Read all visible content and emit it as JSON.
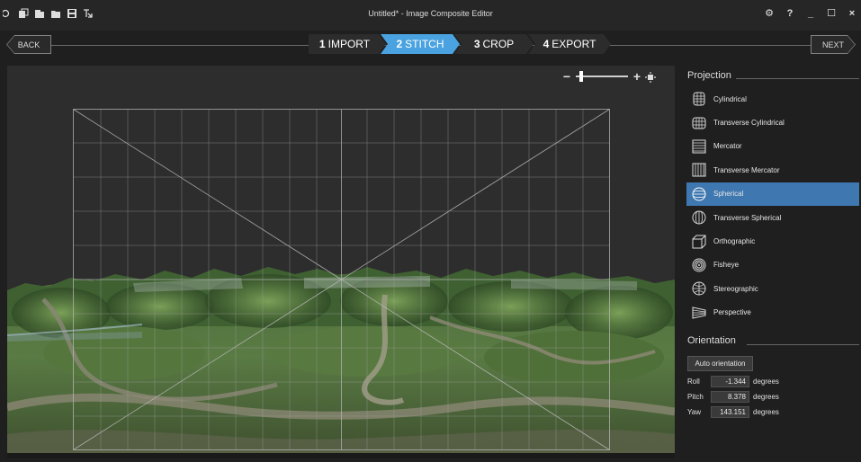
{
  "window": {
    "title": "Untitled* - Image Composite Editor",
    "controls": [
      "⚙",
      "?",
      "_",
      "☐",
      "×"
    ]
  },
  "toolbar_icons": [
    "new-project-icon",
    "new-panorama-icon",
    "open-icon",
    "save-icon",
    "export-icon"
  ],
  "nav": {
    "back_label": "BACK",
    "next_label": "NEXT",
    "steps": [
      {
        "num": "1",
        "label": "IMPORT",
        "active": false
      },
      {
        "num": "2",
        "label": "STITCH",
        "active": true
      },
      {
        "num": "3",
        "label": "CROP",
        "active": false
      },
      {
        "num": "4",
        "label": "EXPORT",
        "active": false
      }
    ]
  },
  "zoom": {
    "minus": "−",
    "plus": "+",
    "level": 0.07
  },
  "projection": {
    "heading": "Projection",
    "items": [
      {
        "label": "Cylindrical",
        "icon": "cylindrical-icon",
        "selected": false
      },
      {
        "label": "Transverse Cylindrical",
        "icon": "transverse-cylindrical-icon",
        "selected": false
      },
      {
        "label": "Mercator",
        "icon": "mercator-icon",
        "selected": false
      },
      {
        "label": "Transverse Mercator",
        "icon": "transverse-mercator-icon",
        "selected": false
      },
      {
        "label": "Spherical",
        "icon": "spherical-icon",
        "selected": true
      },
      {
        "label": "Transverse Spherical",
        "icon": "transverse-spherical-icon",
        "selected": false
      },
      {
        "label": "Orthographic",
        "icon": "orthographic-icon",
        "selected": false
      },
      {
        "label": "Fisheye",
        "icon": "fisheye-icon",
        "selected": false
      },
      {
        "label": "Stereographic",
        "icon": "stereographic-icon",
        "selected": false
      },
      {
        "label": "Perspective",
        "icon": "perspective-icon",
        "selected": false
      }
    ]
  },
  "orientation": {
    "heading": "Orientation",
    "auto_button": "Auto orientation",
    "fields": [
      {
        "label": "Roll",
        "value": "-1.344",
        "unit": "degrees"
      },
      {
        "label": "Pitch",
        "value": "8.378",
        "unit": "degrees"
      },
      {
        "label": "Yaw",
        "value": "143.151",
        "unit": "degrees"
      }
    ]
  },
  "colors": {
    "accent": "#4aa3e0",
    "selected": "#3f77b0",
    "canvas": "#2d2d2d"
  }
}
